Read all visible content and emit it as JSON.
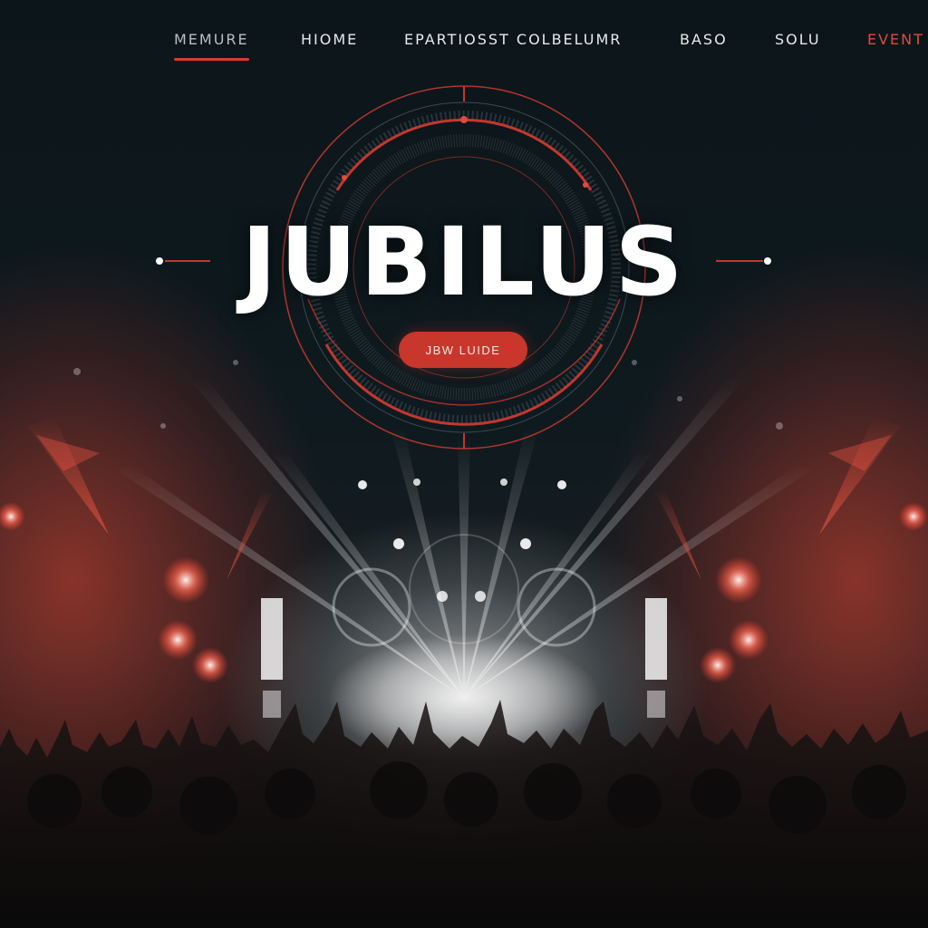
{
  "nav": {
    "items": [
      {
        "label": "MEMURE",
        "active": true
      },
      {
        "label": "HIOME",
        "active": false
      },
      {
        "label": "EPARTIOSST COLBELUMR",
        "active": false
      },
      {
        "label": "BASO",
        "active": false
      },
      {
        "label": "SOLU",
        "active": false
      },
      {
        "label": "EVENT",
        "active": false
      }
    ]
  },
  "hero": {
    "title": "JUBILUS",
    "cta_label": "JBW LUIDE"
  },
  "colors": {
    "accent": "#d63c32",
    "background": "#0c1418",
    "text": "#ffffff"
  },
  "icons": [
    "concentric-ring-emblem",
    "stage-light-beams",
    "crowd-silhouette"
  ]
}
